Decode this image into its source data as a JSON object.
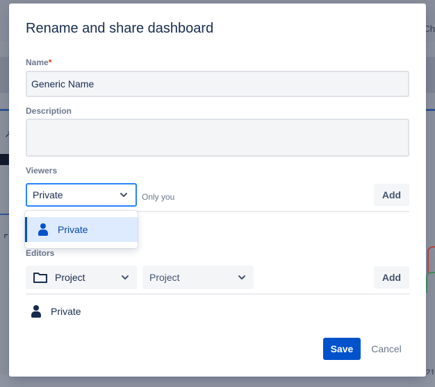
{
  "background": {
    "right_top_text": "Ch",
    "right_bottom_text": "21"
  },
  "dialog": {
    "title": "Rename and share dashboard",
    "name": {
      "label": "Name",
      "required_mark": "*",
      "value": "Generic Name"
    },
    "description": {
      "label": "Description",
      "value": ""
    },
    "viewers": {
      "label": "Viewers",
      "select_value": "Private",
      "hint": "Only you",
      "add_label": "Add",
      "dropdown_options": [
        {
          "label": "Private",
          "icon": "person-icon",
          "selected": true
        }
      ]
    },
    "editors": {
      "label": "Editors",
      "type_select": {
        "value": "Project",
        "icon": "folder-icon"
      },
      "project_select": {
        "value": "Project"
      },
      "add_label": "Add",
      "entries": [
        {
          "label": "Private",
          "icon": "person-icon"
        }
      ]
    },
    "footer": {
      "save_label": "Save",
      "cancel_label": "Cancel"
    }
  },
  "colors": {
    "primary": "#0052cc",
    "focus": "#2684ff",
    "selected_bg": "#deebff",
    "required": "#de350b"
  }
}
